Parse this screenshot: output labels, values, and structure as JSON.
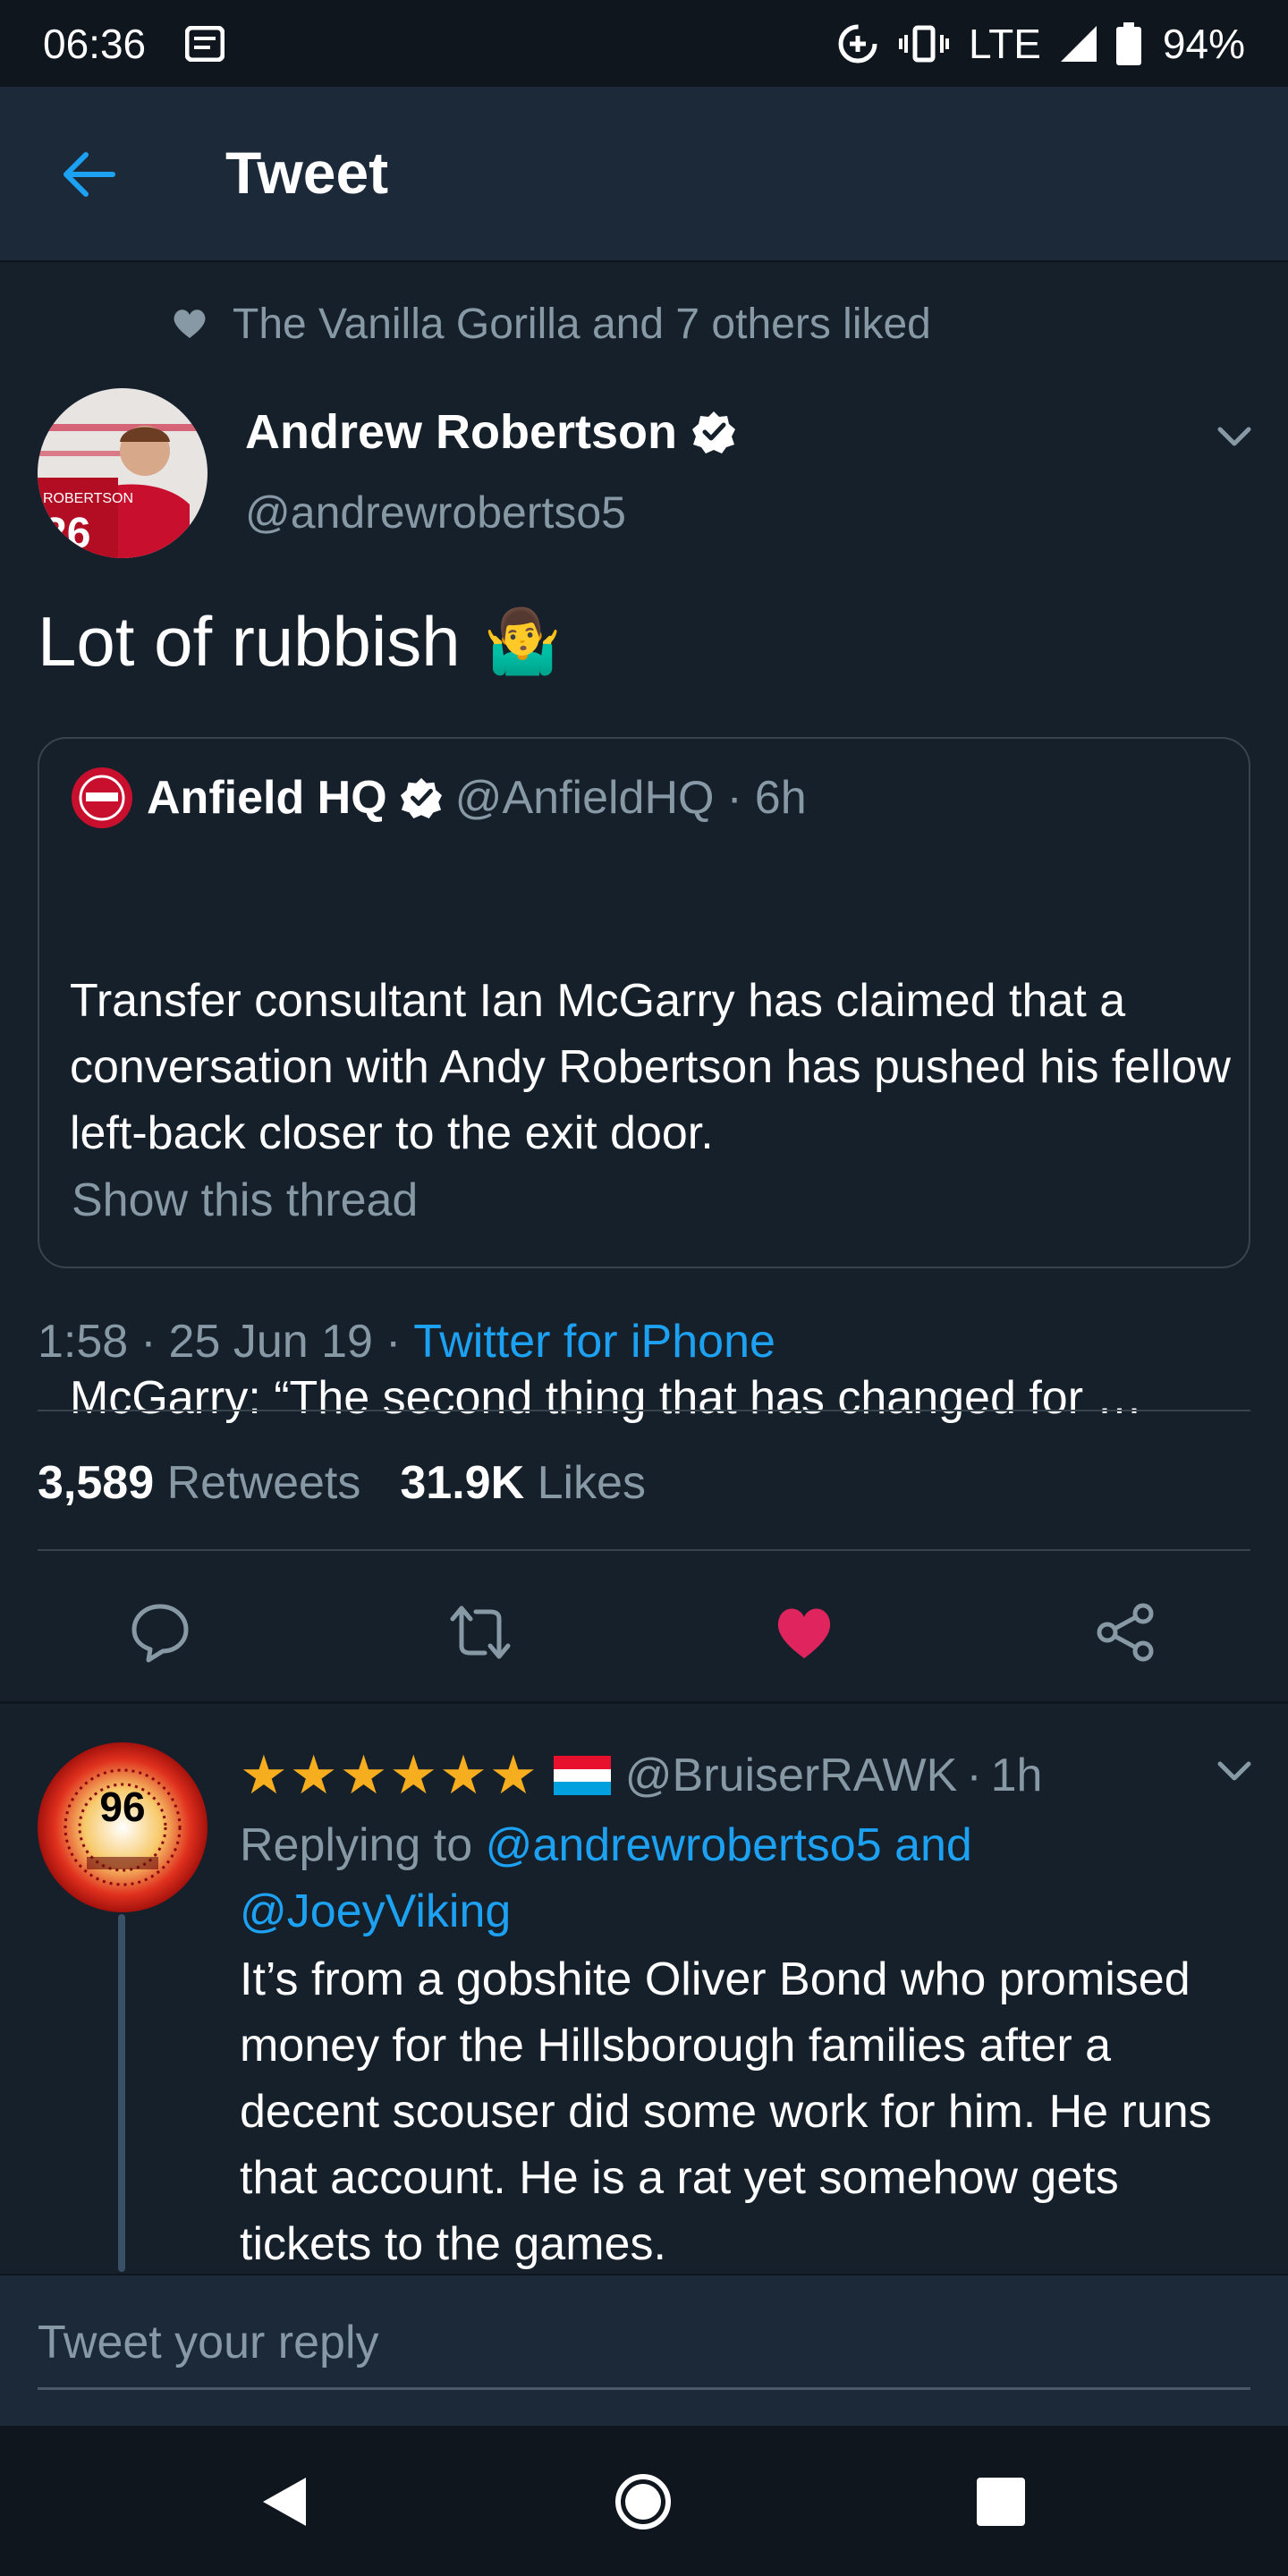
{
  "status_bar": {
    "time": "06:36",
    "network": "LTE",
    "battery": "94%"
  },
  "app_bar": {
    "title": "Tweet"
  },
  "liked_by": "The Vanilla Gorilla and 7 others liked",
  "tweet": {
    "author_name": "Andrew Robertson",
    "author_handle": "@andrewrobertso5",
    "text": "Lot of rubbish",
    "emoji": "🤷‍♂️",
    "time": "1:58",
    "date": "25 Jun 19",
    "source": "Twitter for iPhone",
    "retweets_count": "3,589",
    "retweets_label": "Retweets",
    "likes_count": "31.9K",
    "likes_label": "Likes",
    "liked": true
  },
  "quoted_tweet": {
    "name": "Anfield HQ",
    "handle": "@AnfieldHQ",
    "time": "6h",
    "body_line1": "Transfer consultant Ian McGarry has claimed that a conversation with Andy Robertson has pushed his fellow left-back closer to the exit door.",
    "body_line2": "McGarry: “The second thing that has changed for …",
    "show_thread": "Show this thread"
  },
  "reply": {
    "stars": "★★★★★★",
    "handle": "@BruiserRAWK",
    "time": "1h",
    "replying_prefix": "Replying to",
    "replying_to": "@andrewrobertso5 and @JoeyViking",
    "text": "It’s from a gobshite Oliver Bond who promised money for the Hillsborough families after a decent scouser did some work for him. He runs that account. He is a rat yet somehow gets tickets to the games.",
    "avatar_text": "96"
  },
  "compose": {
    "placeholder": "Tweet your reply"
  },
  "colors": {
    "background": "#15202b",
    "accent": "#1da1f2",
    "like": "#e0245e",
    "muted": "#8899a6"
  }
}
